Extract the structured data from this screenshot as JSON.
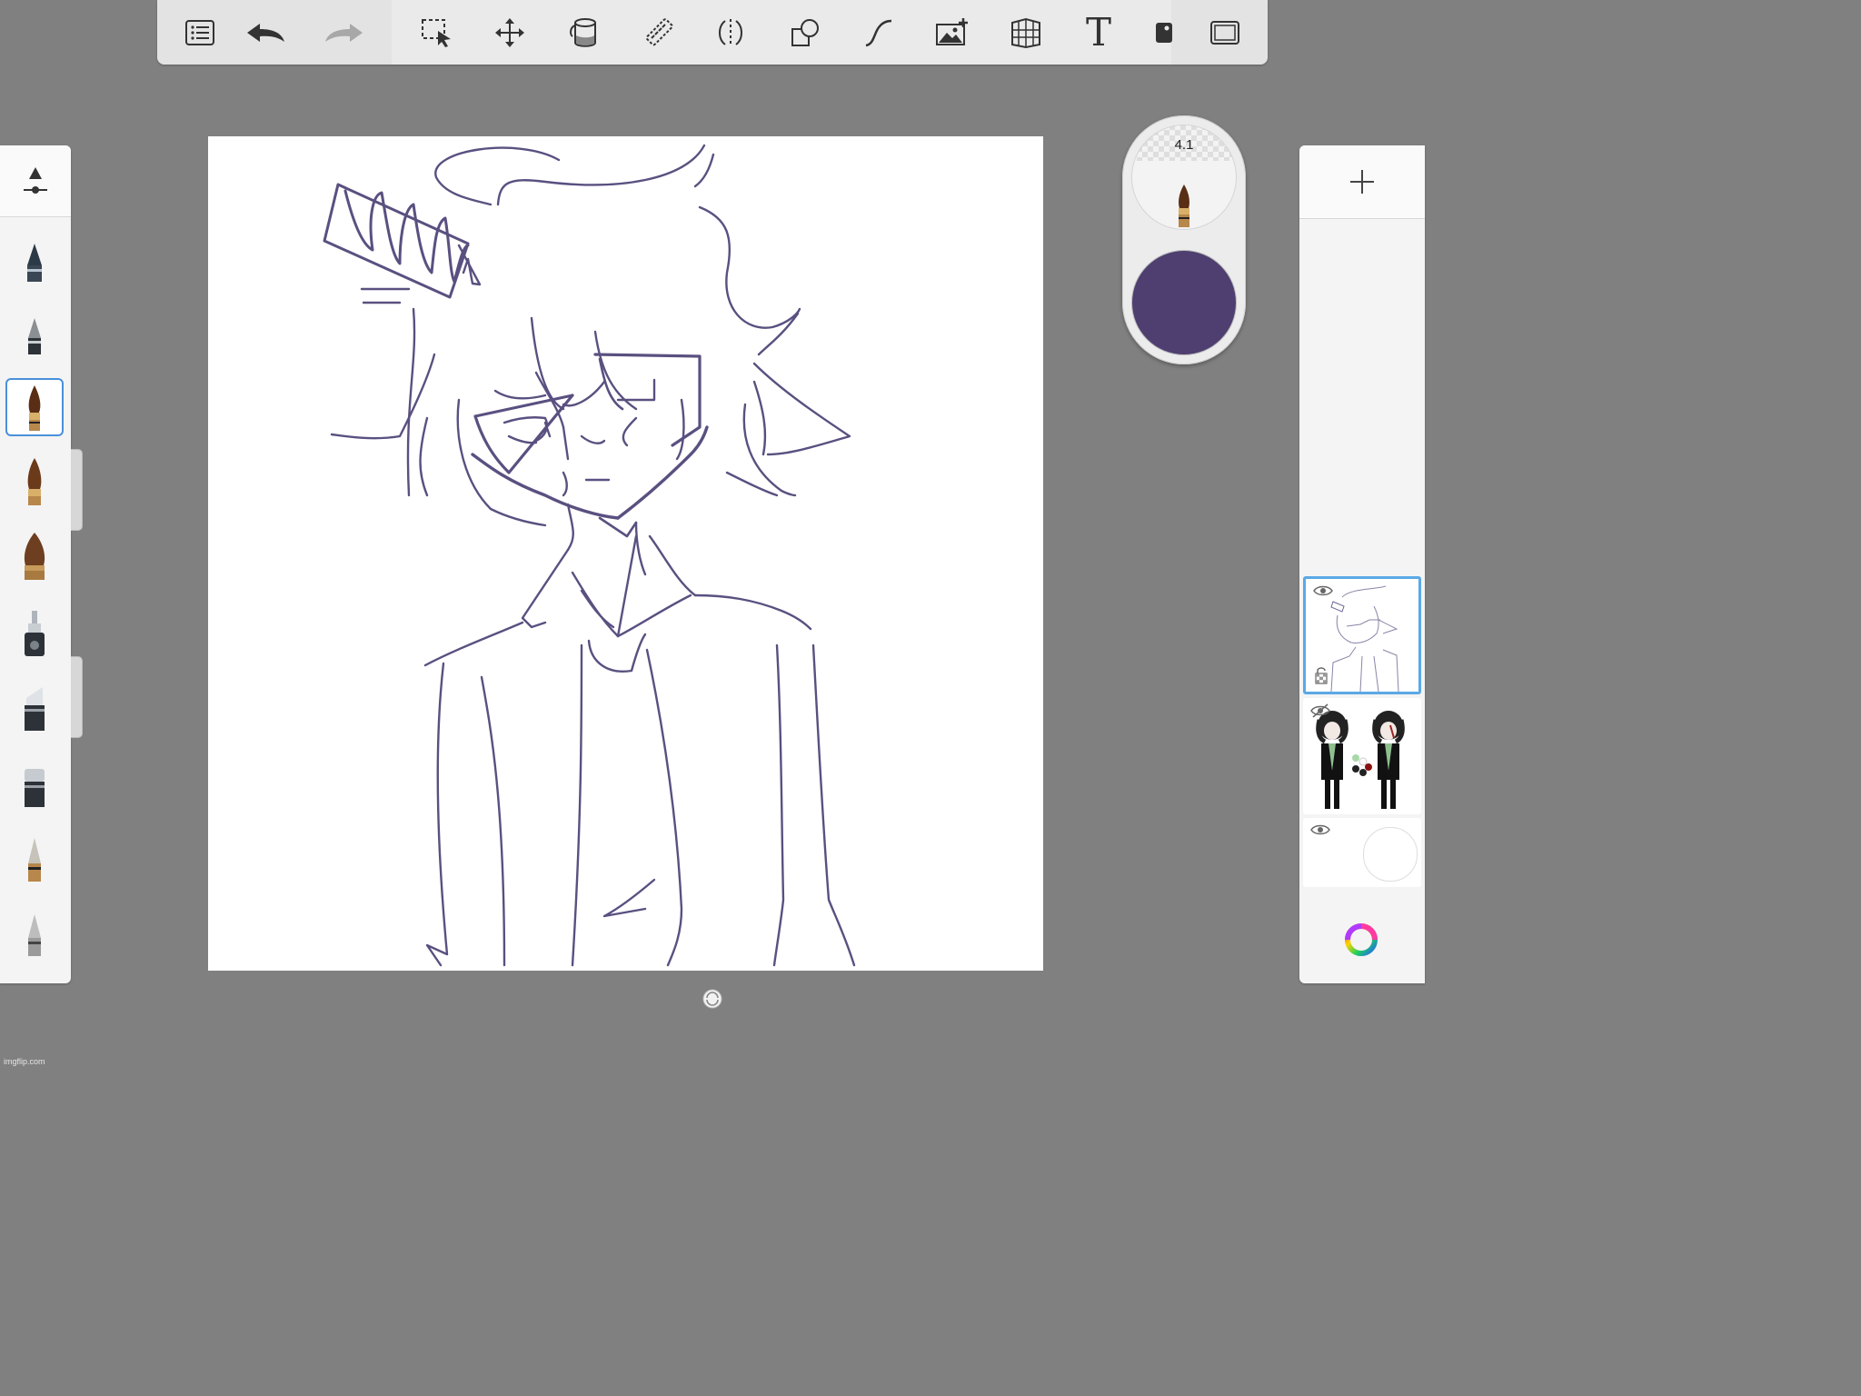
{
  "toolbar": {
    "items": [
      {
        "name": "list-icon"
      },
      {
        "name": "undo-icon"
      },
      {
        "name": "redo-icon"
      },
      {
        "name": "selection-icon"
      },
      {
        "name": "transform-icon"
      },
      {
        "name": "fill-bucket-icon"
      },
      {
        "name": "ruler-icon"
      },
      {
        "name": "symmetry-icon"
      },
      {
        "name": "shapes-icon"
      },
      {
        "name": "curve-icon"
      },
      {
        "name": "add-image-icon"
      },
      {
        "name": "perspective-icon"
      },
      {
        "name": "text-icon"
      },
      {
        "name": "scan-icon"
      },
      {
        "name": "fullscreen-icon"
      }
    ],
    "text_glyph": "T"
  },
  "brushes": [
    {
      "name": "pencil-brush"
    },
    {
      "name": "airbrush-brush"
    },
    {
      "name": "paint-brush",
      "selected": true
    },
    {
      "name": "soft-brush"
    },
    {
      "name": "flat-brush"
    },
    {
      "name": "ink-pen-brush"
    },
    {
      "name": "marker-brush"
    },
    {
      "name": "chisel-brush"
    },
    {
      "name": "blender-brush"
    },
    {
      "name": "eraser-brush"
    }
  ],
  "puck": {
    "brush_size": "4.1",
    "color": "#4e3f70"
  },
  "layers": [
    {
      "name": "sketch-layer",
      "selected": true,
      "visible": true
    },
    {
      "name": "reference-layer",
      "selected": false,
      "visible": false
    },
    {
      "name": "background-layer",
      "selected": false,
      "visible": true
    }
  ],
  "colors": {
    "background": "#808080",
    "stroke": "#5a5080",
    "selection": "#5aa9e6"
  },
  "watermark": "imgflip.com"
}
